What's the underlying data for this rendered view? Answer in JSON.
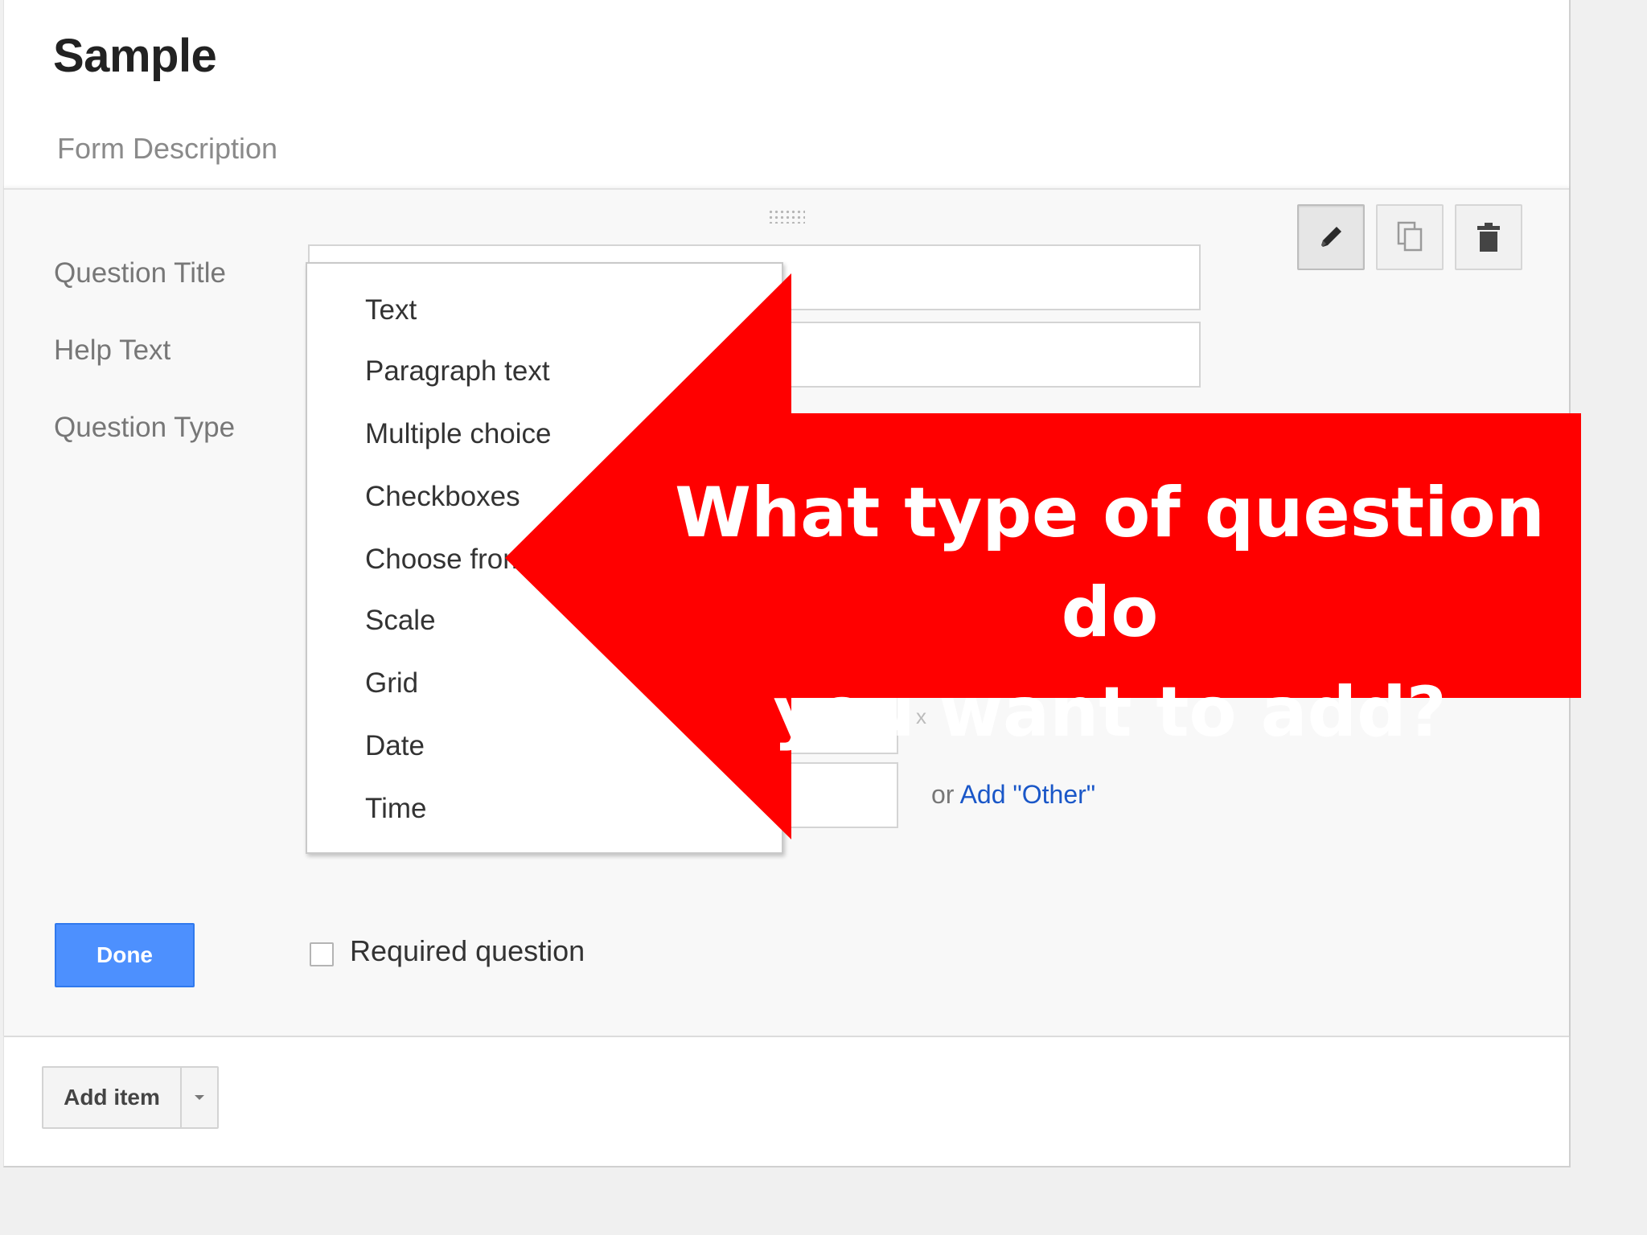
{
  "form": {
    "title": "Sample",
    "description_placeholder": "Form Description"
  },
  "question": {
    "title_label": "Question Title",
    "help_label": "Help Text",
    "type_label": "Question Type",
    "toolbar": {
      "edit_icon": "pencil-icon",
      "duplicate_icon": "duplicate-icon",
      "delete_icon": "trash-icon"
    },
    "remove_option": "x",
    "other_prefix": "or",
    "other_link": "Add \"Other\""
  },
  "type_menu": {
    "items": [
      "Text",
      "Paragraph text",
      "Multiple choice",
      "Checkboxes",
      "Choose from",
      "Scale",
      "Grid",
      "Date",
      "Time"
    ]
  },
  "footer": {
    "done_label": "Done",
    "required_label": "Required question",
    "required_checked": false,
    "add_item_label": "Add item"
  },
  "callout": {
    "line1": "What type of question do",
    "line2": "you want to add?",
    "color": "#ff0000"
  },
  "colors": {
    "primary_button": "#4d90fe",
    "link": "#1a57c8"
  }
}
